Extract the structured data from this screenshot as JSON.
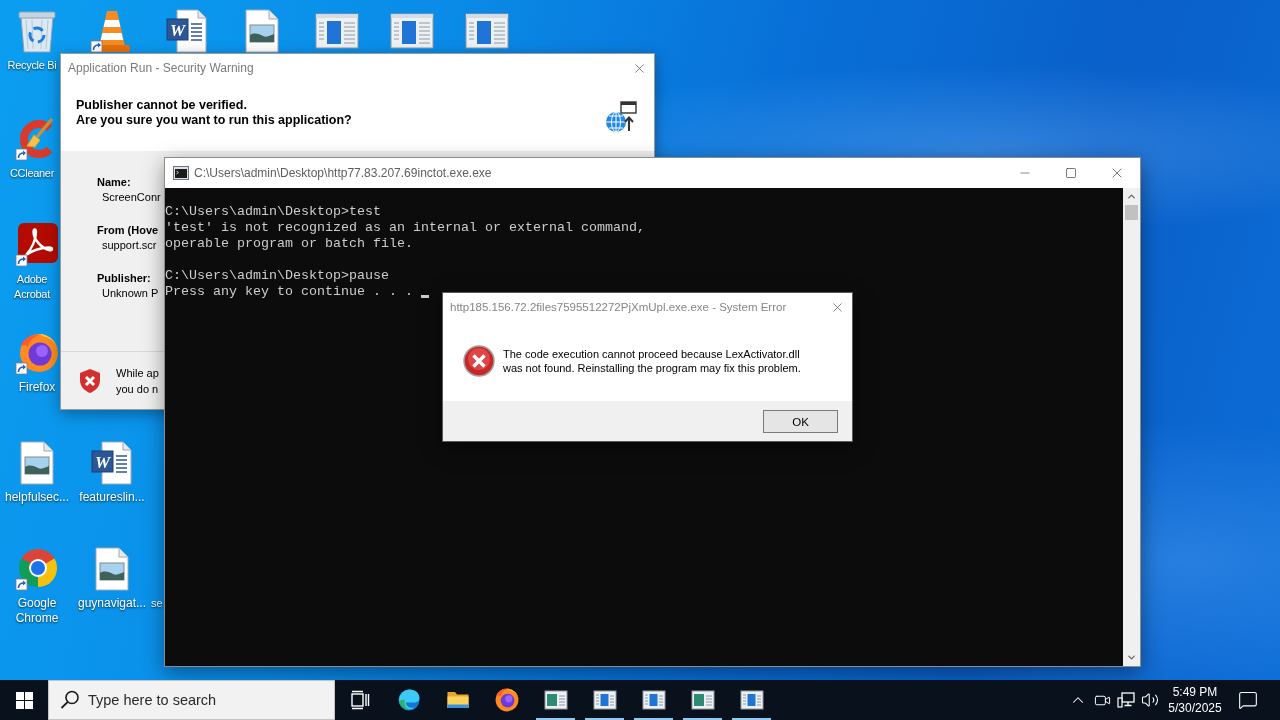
{
  "desktop_icons": [
    {
      "kind": "recycle-bin",
      "label": "Recycle Bi",
      "shortcut": false
    },
    {
      "kind": "cone",
      "shortcut": true
    },
    {
      "kind": "word-document",
      "letter": "W",
      "shortcut": false
    },
    {
      "kind": "image-file",
      "shortcut": false
    },
    {
      "kind": "window-file",
      "shortcut": false
    },
    {
      "kind": "window-file",
      "shortcut": false
    },
    {
      "kind": "window-file",
      "shortcut": false
    },
    {
      "kind": "ccleaner",
      "label": "CCleaner",
      "shortcut": true
    },
    {
      "kind": "acrobat",
      "label": "Adobe Acrobat",
      "shortcut": true
    },
    {
      "kind": "firefox",
      "label": "Firefox",
      "shortcut": true
    },
    {
      "kind": "image-file",
      "label": "helpfulsec...",
      "shortcut": false
    },
    {
      "kind": "word-document",
      "letter": "W",
      "label": "featureslin...",
      "shortcut": false
    },
    {
      "kind": "chrome",
      "label": "Google Chrome",
      "shortcut": true
    },
    {
      "kind": "image-file",
      "label": "guynavigat...",
      "shortcut": false
    },
    {
      "kind": "hidden",
      "label": "se"
    }
  ],
  "security_dialog": {
    "title": "Application Run - Security Warning",
    "heading": "Publisher cannot be verified.",
    "question": "Are you sure you want to run this application?",
    "fields": [
      {
        "label": "Name:",
        "value": "ScreenConr"
      },
      {
        "label": "From (Hove",
        "value": "support.scr"
      },
      {
        "label": "Publisher:",
        "value": "Unknown P"
      }
    ],
    "warning": "While ap\nyou do n"
  },
  "console": {
    "title": "C:\\Users\\admin\\Desktop\\http77.83.207.69inctot.exe.exe",
    "blocks": [
      {
        "lines": [
          "C:\\Users\\admin\\Desktop>test",
          "'test' is not recognized as an internal or external command,",
          "operable program or batch file."
        ]
      },
      {
        "lines": [
          "C:\\Users\\admin\\Desktop>pause",
          "Press any key to continue . . ."
        ]
      }
    ],
    "cursor": true
  },
  "error_dialog": {
    "title": "http185.156.72.2files7595512272PjXmUpl.exe.exe - System Error",
    "message": "The code execution cannot proceed because LexActivator.dll\nwas not found. Reinstalling the program may fix this problem.",
    "button": "OK"
  },
  "taskbar": {
    "search": {
      "placeholder": "Type here to search"
    },
    "apps": [
      {
        "kind": "edge",
        "running": false
      },
      {
        "kind": "folder",
        "running": false
      },
      {
        "kind": "firefox",
        "running": false
      },
      {
        "kind": "picture-window",
        "running": true
      },
      {
        "kind": "panel-window",
        "running": true
      },
      {
        "kind": "panel-window",
        "running": true
      },
      {
        "kind": "picture-window",
        "running": true
      },
      {
        "kind": "panel-window",
        "running": true
      }
    ],
    "clock": {
      "time": "5:49 PM",
      "date": "5/30/2025"
    }
  }
}
